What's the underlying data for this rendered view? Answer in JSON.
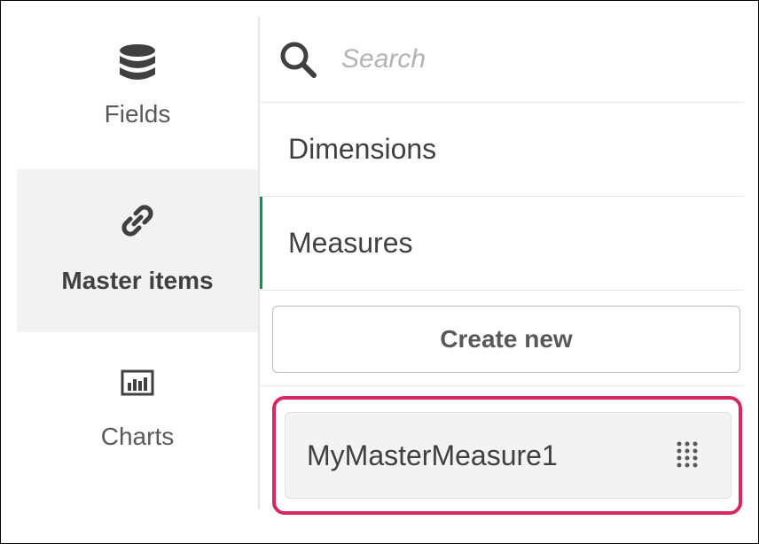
{
  "nav": {
    "items": [
      {
        "label": "Fields",
        "icon": "database-icon",
        "active": false
      },
      {
        "label": "Master items",
        "icon": "link-icon",
        "active": true
      },
      {
        "label": "Charts",
        "icon": "bar-chart-icon",
        "active": false
      }
    ]
  },
  "panel": {
    "search": {
      "placeholder": "Search",
      "value": ""
    },
    "tabs": [
      {
        "label": "Dimensions",
        "active": false
      },
      {
        "label": "Measures",
        "active": true
      }
    ],
    "create_label": "Create new",
    "items": [
      {
        "label": "MyMasterMeasure1",
        "highlighted": true
      }
    ]
  },
  "colors": {
    "active_tab_accent": "#009845",
    "highlight_border": "#d6285f",
    "active_nav_bg": "#f2f2f2"
  }
}
